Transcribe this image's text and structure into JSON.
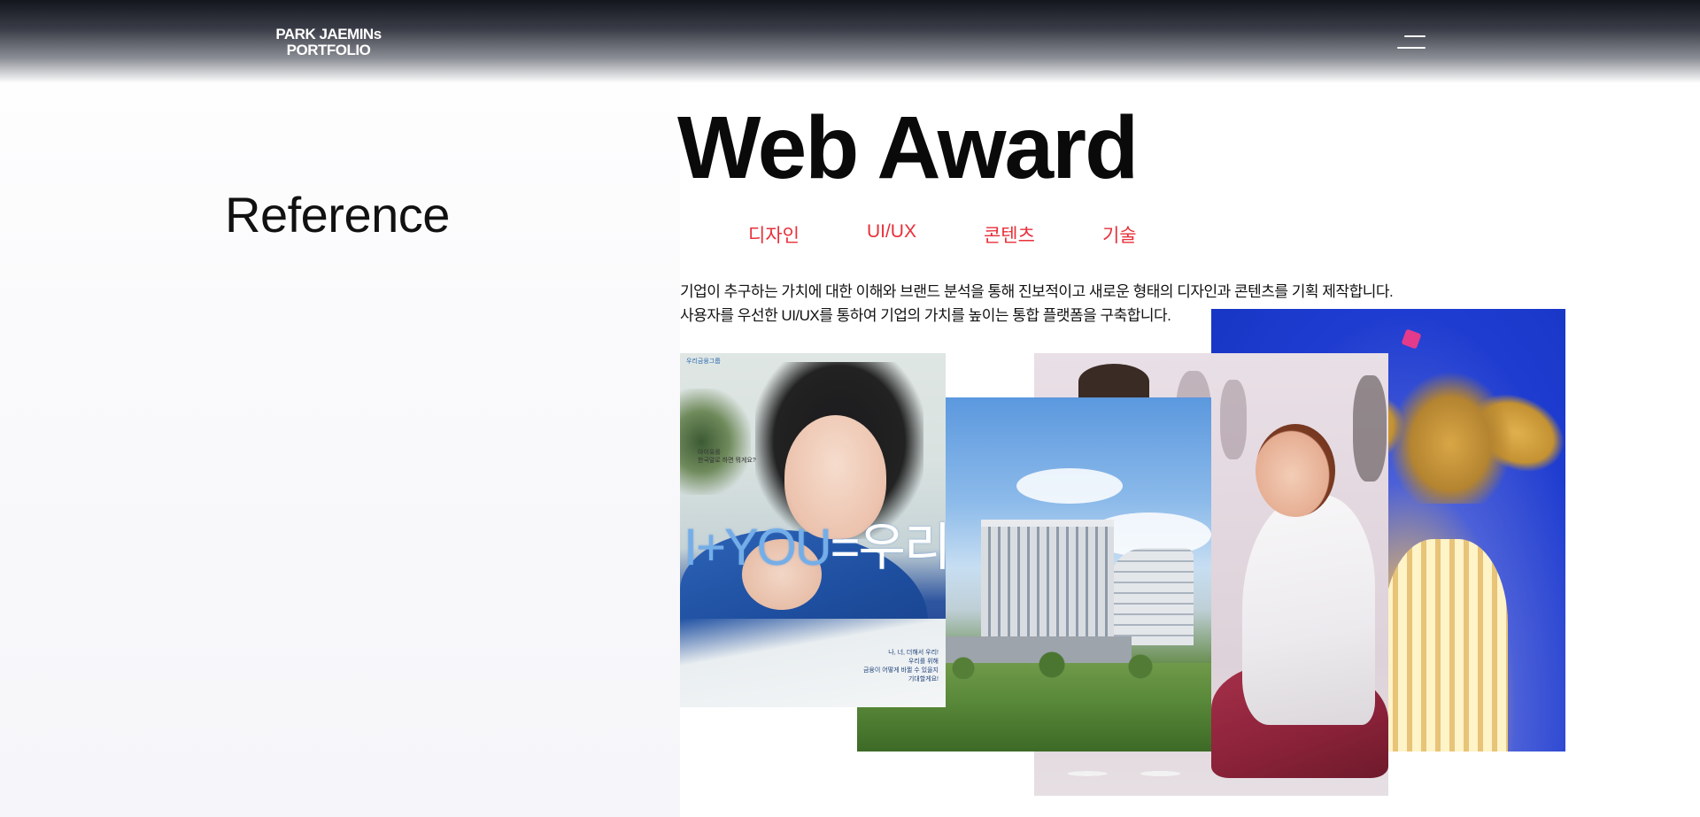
{
  "header": {
    "logo_line1": "PARK JAEMINs",
    "logo_line2": "PORTFOLIO",
    "menu_icon": "hamburger-menu-icon"
  },
  "section": {
    "title": "Reference"
  },
  "main": {
    "title": "Web Award",
    "tabs": [
      {
        "label": "디자인"
      },
      {
        "label": "UI/UX"
      },
      {
        "label": "콘텐츠"
      },
      {
        "label": "기술"
      }
    ],
    "description_line1": "기업이 추구하는 가치에 대한 이해와 브랜드 분석을 통해 진보적이고 새로운 형태의 디자인과 콘텐츠를 기획 제작합니다.",
    "description_line2": "사용자를 우선한 UI/UX를 통하여 기업의 가치를 높이는 통합 플랫폼을 구축합니다."
  },
  "cards": {
    "iu": {
      "brand": "우리금융그룹",
      "small_copy_1": "아이유를",
      "small_copy_2": "한국말로 하면 뭐게요?",
      "headline_en": "I+YOU",
      "headline_eq": "=",
      "headline_kr": "우리",
      "bottom_1": "나, 너, 더해서 우리!",
      "bottom_2": "우리를 위해",
      "bottom_3": "금융이 어떻게 바뀔 수 있을지",
      "bottom_4": "기대할게요!"
    }
  },
  "colors": {
    "accent": "#e8303a",
    "heading": "#0a0a0a",
    "header_dark": "#14161e"
  }
}
